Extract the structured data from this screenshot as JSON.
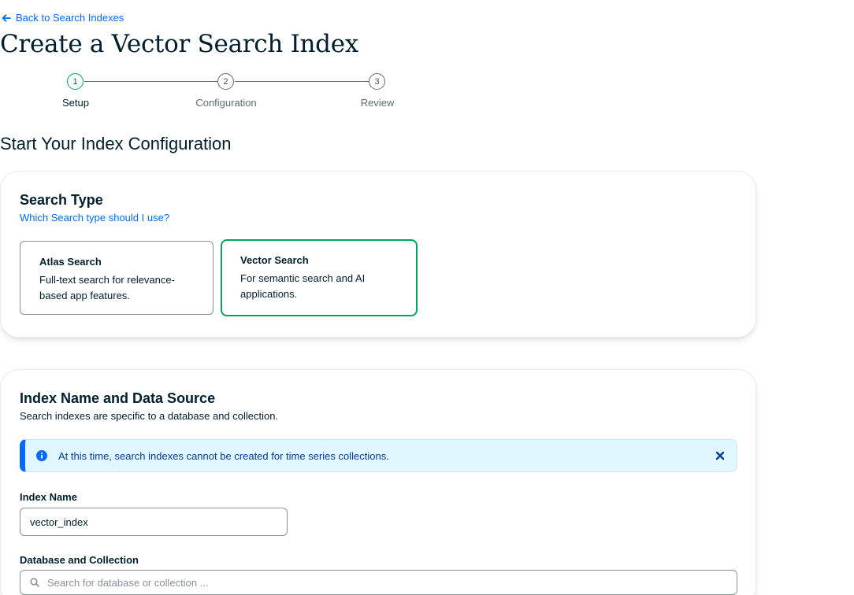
{
  "nav": {
    "back_label": "Back to Search Indexes"
  },
  "page": {
    "title": "Create a Vector Search Index",
    "section_title": "Start Your Index Configuration"
  },
  "stepper": {
    "steps": [
      {
        "number": "1",
        "label": "Setup",
        "active": true
      },
      {
        "number": "2",
        "label": "Configuration",
        "active": false
      },
      {
        "number": "3",
        "label": "Review",
        "active": false
      }
    ]
  },
  "search_type": {
    "heading": "Search Type",
    "help_link": "Which Search type should I use?",
    "options": [
      {
        "title": "Atlas Search",
        "description": "Full-text search for relevance-based app features.",
        "selected": false
      },
      {
        "title": "Vector Search",
        "description": "For semantic search and AI applications.",
        "selected": true
      }
    ]
  },
  "index_source": {
    "heading": "Index Name and Data Source",
    "description": "Search indexes are specific to a database and collection.",
    "banner_text": "At this time, search indexes cannot be created for time series collections.",
    "index_name_label": "Index Name",
    "index_name_value": "vector_index",
    "db_collection_label": "Database and Collection",
    "db_search_placeholder": "Search for database or collection ..."
  },
  "colors": {
    "brand_green": "#00a35c",
    "link_blue": "#016bf8",
    "banner_bg": "#e1f7ff",
    "text_dark": "#001e2b"
  },
  "icons": {
    "back": "arrow-left-icon",
    "info": "info-icon",
    "close": "close-icon",
    "search": "search-icon"
  }
}
